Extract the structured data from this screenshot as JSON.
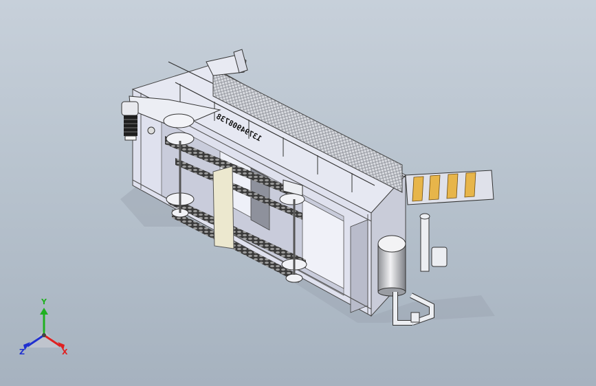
{
  "viewport": {
    "background_top": "#c7d0da",
    "background_bottom": "#a6b2bf"
  },
  "model": {
    "side_text": "13794908738",
    "frame_color": "#e4e6f0",
    "chain_color": "#2a2a2a",
    "door_color": "#ece8cf"
  },
  "triad": {
    "x_label": "X",
    "y_label": "Y",
    "z_label": "Z",
    "x_color": "#e02020",
    "y_color": "#20b020",
    "z_color": "#2030d0"
  }
}
